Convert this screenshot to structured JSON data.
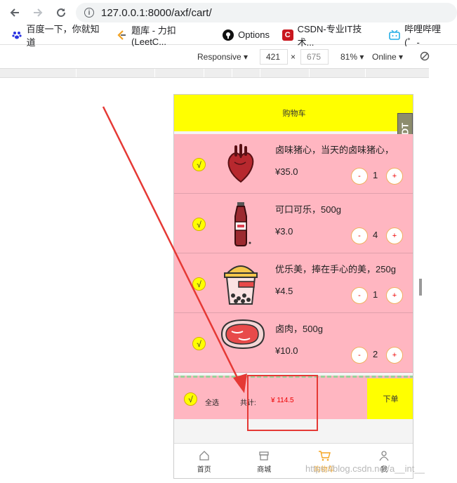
{
  "browser": {
    "url": "127.0.0.1:8000/axf/cart/",
    "bookmarks": [
      {
        "label": "百度一下，你就知道",
        "icon": "paw-icon"
      },
      {
        "label": "题库 - 力扣 (LeetC...",
        "icon": "leetcode-icon"
      },
      {
        "label": "Options",
        "icon": "github-icon"
      },
      {
        "label": "CSDN-专业IT技术...",
        "icon": "csdn-icon"
      },
      {
        "label": "哔哩哔哩 (゜-",
        "icon": "bilibili-icon"
      }
    ]
  },
  "devtools": {
    "mode": "Responsive",
    "width": "421",
    "times": "×",
    "height": "675",
    "zoom": "81%",
    "network": "Online"
  },
  "page": {
    "header_title": "购物车",
    "dt_badge": "D:DT",
    "items": [
      {
        "name": "卤味猪心，当天的卤味猪心，",
        "price": "¥35.0",
        "qty": "1",
        "check": "√",
        "minus": "-",
        "plus": "+",
        "image": "heart"
      },
      {
        "name": "可口可乐，500g",
        "price": "¥3.0",
        "qty": "4",
        "check": "√",
        "minus": "-",
        "plus": "+",
        "image": "cola"
      },
      {
        "name": "优乐美，捧在手心的美，250g",
        "price": "¥4.5",
        "qty": "1",
        "check": "√",
        "minus": "-",
        "plus": "+",
        "image": "milktea"
      },
      {
        "name": "卤肉，500g",
        "price": "¥10.0",
        "qty": "2",
        "check": "√",
        "minus": "-",
        "plus": "+",
        "image": "meat"
      }
    ],
    "footer": {
      "check": "√",
      "select_all": "全选",
      "total_label": "共计:",
      "total_amount": "¥ 114.5",
      "order_button": "下单"
    },
    "tabs": [
      {
        "label": "首页",
        "icon": "home-icon"
      },
      {
        "label": "商城",
        "icon": "shop-icon"
      },
      {
        "label": "购物车",
        "icon": "cart-icon",
        "active": true
      },
      {
        "label": "我",
        "icon": "user-icon"
      }
    ]
  },
  "watermark": "https://blog.csdn.net/a__int__",
  "colors": {
    "header": "#ffff00",
    "item_bg": "#ffb6c1",
    "price_total": "#e00000",
    "annotation": "#e53935",
    "tab_active": "#f5a623"
  }
}
